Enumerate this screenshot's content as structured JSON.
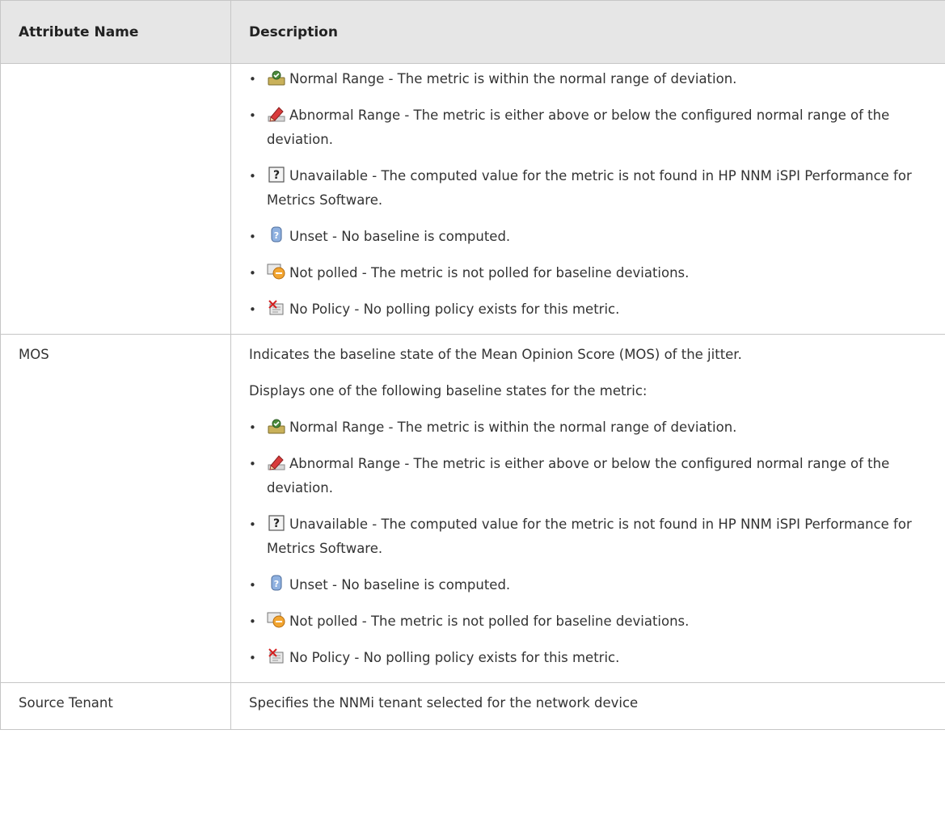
{
  "table": {
    "headers": {
      "name": "Attribute Name",
      "description": "Description"
    },
    "states": [
      {
        "icon": "normal-range-icon",
        "text": "Normal Range - The metric is within the normal range of deviation."
      },
      {
        "icon": "abnormal-range-icon",
        "text": "Abnormal Range - The metric is either above or below the configured normal range of the deviation."
      },
      {
        "icon": "unavailable-icon",
        "text": "Unavailable - The computed value for the metric is not found in HP NNM iSPI Performance for Metrics Software."
      },
      {
        "icon": "unset-icon",
        "text": "Unset - No baseline is computed."
      },
      {
        "icon": "not-polled-icon",
        "text": "Not polled - The metric is not polled for baseline deviations."
      },
      {
        "icon": "no-policy-icon",
        "text": "No Policy - No polling policy exists for this metric."
      }
    ],
    "mos": {
      "name": "MOS",
      "intro": "Indicates the baseline state of the Mean Opinion Score (MOS) of the jitter.",
      "lead": "Displays one of the following baseline states for the metric:"
    },
    "source_tenant": {
      "name": "Source Tenant",
      "description": "Specifies the NNMi tenant selected for the network device"
    }
  }
}
